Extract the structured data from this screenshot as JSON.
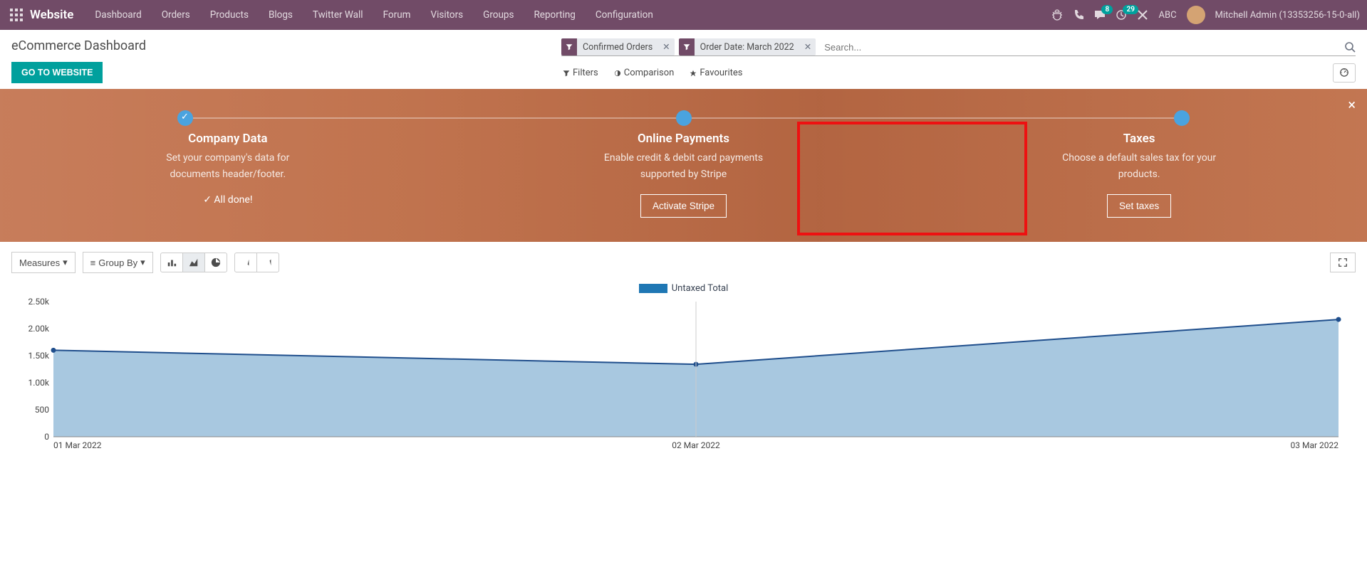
{
  "nav": {
    "brand": "Website",
    "menu": [
      "Dashboard",
      "Orders",
      "Products",
      "Blogs",
      "Twitter Wall",
      "Forum",
      "Visitors",
      "Groups",
      "Reporting",
      "Configuration"
    ],
    "msg_badge": "8",
    "clock_badge": "29",
    "dbname": "ABC",
    "username": "Mitchell Admin (13353256-15-0-all)"
  },
  "cp": {
    "title": "eCommerce Dashboard",
    "go_btn": "GO TO WEBSITE",
    "facet1": "Confirmed Orders",
    "facet2": "Order Date: March 2022",
    "search_placeholder": "Search...",
    "filters": "Filters",
    "comparison": "Comparison",
    "favourites": "Favourites"
  },
  "onboard": {
    "step1": {
      "title": "Company Data",
      "line1": "Set your company's data for",
      "line2": "documents header/footer.",
      "done": "All done!"
    },
    "step2": {
      "title": "Online Payments",
      "line1": "Enable credit & debit card payments",
      "line2": "supported by Stripe",
      "btn": "Activate Stripe"
    },
    "step3": {
      "title": "Taxes",
      "line1": "Choose a default sales tax for your",
      "line2": "products.",
      "btn": "Set taxes"
    }
  },
  "gtoolbar": {
    "measures": "Measures",
    "groupby": "Group By"
  },
  "chart_data": {
    "type": "area",
    "title": "",
    "series_name": "Untaxed Total",
    "categories": [
      "01 Mar 2022",
      "02 Mar 2022",
      "03 Mar 2022"
    ],
    "values": [
      1600,
      1340,
      2170
    ],
    "ylim": [
      0,
      2500
    ],
    "yticks": [
      "0",
      "500",
      "1.00k",
      "1.50k",
      "2.00k",
      "2.50k"
    ],
    "xlabel": "",
    "ylabel": ""
  }
}
